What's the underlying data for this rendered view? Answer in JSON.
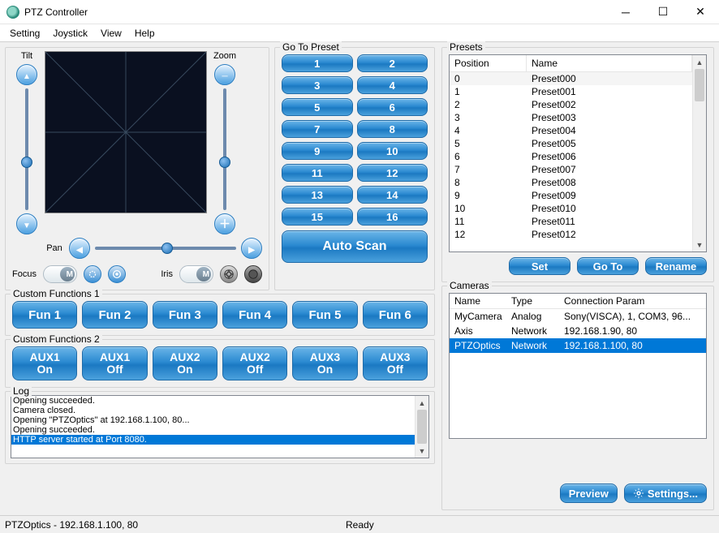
{
  "title": "PTZ Controller",
  "menu": {
    "setting": "Setting",
    "joystick": "Joystick",
    "view": "View",
    "help": "Help"
  },
  "ptz": {
    "tilt_label": "Tilt",
    "zoom_label": "Zoom",
    "pan_label": "Pan",
    "focus_label": "Focus",
    "iris_label": "Iris",
    "toggle_m": "M"
  },
  "goto": {
    "legend": "Go To Preset",
    "nums": [
      "1",
      "2",
      "3",
      "4",
      "5",
      "6",
      "7",
      "8",
      "9",
      "10",
      "11",
      "12",
      "13",
      "14",
      "15",
      "16"
    ],
    "autoscan": "Auto Scan"
  },
  "cf1": {
    "legend": "Custom Functions 1",
    "buttons": [
      "Fun 1",
      "Fun 2",
      "Fun 3",
      "Fun 4",
      "Fun 5",
      "Fun 6"
    ]
  },
  "cf2": {
    "legend": "Custom Functions 2",
    "buttons": [
      {
        "l1": "AUX1",
        "l2": "On"
      },
      {
        "l1": "AUX1",
        "l2": "Off"
      },
      {
        "l1": "AUX2",
        "l2": "On"
      },
      {
        "l1": "AUX2",
        "l2": "Off"
      },
      {
        "l1": "AUX3",
        "l2": "On"
      },
      {
        "l1": "AUX3",
        "l2": "Off"
      }
    ]
  },
  "log": {
    "legend": "Log",
    "lines": [
      "Opening succeeded.",
      "Camera closed.",
      "Opening \"PTZOptics\" at 192.168.1.100, 80...",
      "Opening succeeded.",
      "HTTP server started at Port 8080."
    ],
    "selected_index": 4
  },
  "presets": {
    "legend": "Presets",
    "col_position": "Position",
    "col_name": "Name",
    "rows": [
      {
        "pos": "0",
        "name": "Preset000"
      },
      {
        "pos": "1",
        "name": "Preset001"
      },
      {
        "pos": "2",
        "name": "Preset002"
      },
      {
        "pos": "3",
        "name": "Preset003"
      },
      {
        "pos": "4",
        "name": "Preset004"
      },
      {
        "pos": "5",
        "name": "Preset005"
      },
      {
        "pos": "6",
        "name": "Preset006"
      },
      {
        "pos": "7",
        "name": "Preset007"
      },
      {
        "pos": "8",
        "name": "Preset008"
      },
      {
        "pos": "9",
        "name": "Preset009"
      },
      {
        "pos": "10",
        "name": "Preset010"
      },
      {
        "pos": "11",
        "name": "Preset011"
      },
      {
        "pos": "12",
        "name": "Preset012"
      }
    ],
    "selected_index": 0,
    "set_btn": "Set",
    "goto_btn": "Go To",
    "rename_btn": "Rename"
  },
  "cameras": {
    "legend": "Cameras",
    "col_name": "Name",
    "col_type": "Type",
    "col_conn": "Connection Param",
    "rows": [
      {
        "name": "MyCamera",
        "type": "Analog",
        "conn": "Sony(VISCA), 1, COM3, 96..."
      },
      {
        "name": "Axis",
        "type": "Network",
        "conn": "192.168.1.90, 80"
      },
      {
        "name": "PTZOptics",
        "type": "Network",
        "conn": "192.168.1.100, 80"
      }
    ],
    "selected_index": 2,
    "preview_btn": "Preview",
    "settings_btn": "Settings..."
  },
  "statusbar": {
    "left": "PTZOptics - 192.168.1.100, 80",
    "mid": "Ready"
  }
}
